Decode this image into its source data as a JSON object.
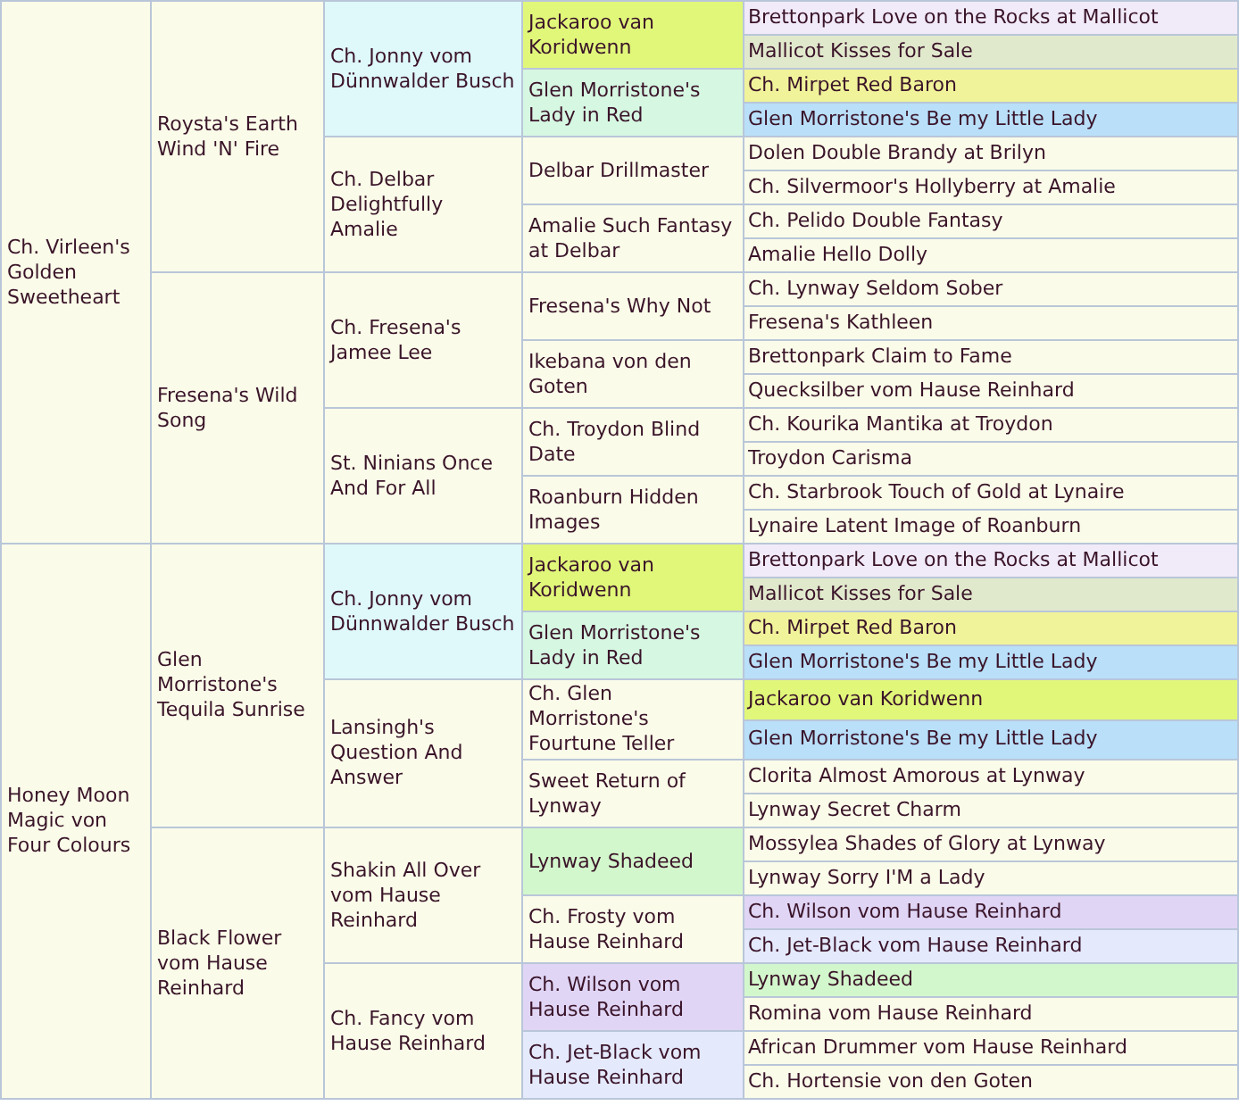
{
  "pedigree": [
    {
      "name": "Ch. Virleen's Golden Sweetheart",
      "children": [
        {
          "name": "Roysta's Earth Wind 'N' Fire",
          "children": [
            {
              "name": "Ch. Jonny vom Dünnwalder Busch",
              "color": "#dff8fa",
              "children": [
                {
                  "name": "Jackaroo van Koridwenn",
                  "color": "#e1f77a",
                  "children": [
                    {
                      "name": "Brettonpark Love on the Rocks at Mallicot",
                      "color": "#f1eaf8"
                    },
                    {
                      "name": "Mallicot Kisses for Sale",
                      "color": "#e1e9cd"
                    }
                  ]
                },
                {
                  "name": "Glen Morristone's Lady in Red",
                  "color": "#d6f7e2",
                  "children": [
                    {
                      "name": "Ch. Mirpet Red Baron",
                      "color": "#f0f39a"
                    },
                    {
                      "name": "Glen Morristone's Be my Little Lady",
                      "color": "#b9dff9"
                    }
                  ]
                }
              ]
            },
            {
              "name": "Ch. Delbar Delightfully Amalie",
              "children": [
                {
                  "name": "Delbar Drillmaster",
                  "children": [
                    {
                      "name": "Dolen Double Brandy at Brilyn"
                    },
                    {
                      "name": "Ch. Silvermoor's Hollyberry at Amalie"
                    }
                  ]
                },
                {
                  "name": "Amalie Such Fantasy at Delbar",
                  "children": [
                    {
                      "name": "Ch. Pelido Double Fantasy"
                    },
                    {
                      "name": "Amalie Hello Dolly"
                    }
                  ]
                }
              ]
            }
          ]
        },
        {
          "name": "Fresena's Wild Song",
          "children": [
            {
              "name": "Ch. Fresena's Jamee Lee",
              "children": [
                {
                  "name": "Fresena's Why Not",
                  "children": [
                    {
                      "name": "Ch. Lynway Seldom Sober"
                    },
                    {
                      "name": "Fresena's Kathleen"
                    }
                  ]
                },
                {
                  "name": "Ikebana von den Goten",
                  "children": [
                    {
                      "name": "Brettonpark Claim to Fame"
                    },
                    {
                      "name": "Quecksilber vom Hause Reinhard"
                    }
                  ]
                }
              ]
            },
            {
              "name": "St. Ninians Once And For All",
              "children": [
                {
                  "name": "Ch. Troydon Blind Date",
                  "children": [
                    {
                      "name": "Ch. Kourika Mantika at Troydon"
                    },
                    {
                      "name": "Troydon Carisma"
                    }
                  ]
                },
                {
                  "name": "Roanburn Hidden Images",
                  "children": [
                    {
                      "name": "Ch. Starbrook Touch of Gold at Lynaire"
                    },
                    {
                      "name": "Lynaire Latent Image of Roanburn"
                    }
                  ]
                }
              ]
            }
          ]
        }
      ]
    },
    {
      "name": "Honey Moon Magic von Four Colours",
      "children": [
        {
          "name": "Glen Morristone's Tequila Sunrise",
          "children": [
            {
              "name": "Ch. Jonny vom Dünnwalder Busch",
              "color": "#dff8fa",
              "children": [
                {
                  "name": "Jackaroo van Koridwenn",
                  "color": "#e1f77a",
                  "children": [
                    {
                      "name": "Brettonpark Love on the Rocks at Mallicot",
                      "color": "#f1eaf8"
                    },
                    {
                      "name": "Mallicot Kisses for Sale",
                      "color": "#e1e9cd"
                    }
                  ]
                },
                {
                  "name": "Glen Morristone's Lady in Red",
                  "color": "#d6f7e2",
                  "children": [
                    {
                      "name": "Ch. Mirpet Red Baron",
                      "color": "#f0f39a"
                    },
                    {
                      "name": "Glen Morristone's Be my Little Lady",
                      "color": "#b9dff9"
                    }
                  ]
                }
              ]
            },
            {
              "name": "Lansingh's Question And Answer",
              "children": [
                {
                  "name": "Ch. Glen Morristone's Fourtune Teller",
                  "children": [
                    {
                      "name": "Jackaroo van Koridwenn",
                      "color": "#e1f77a"
                    },
                    {
                      "name": "Glen Morristone's Be my Little Lady",
                      "color": "#b9dff9"
                    }
                  ]
                },
                {
                  "name": "Sweet Return of Lynway",
                  "children": [
                    {
                      "name": "Clorita Almost Amorous at Lynway"
                    },
                    {
                      "name": "Lynway Secret Charm"
                    }
                  ]
                }
              ]
            }
          ]
        },
        {
          "name": "Black Flower vom Hause Reinhard",
          "children": [
            {
              "name": "Shakin All Over vom Hause Reinhard",
              "children": [
                {
                  "name": "Lynway Shadeed",
                  "color": "#d3f7cc",
                  "children": [
                    {
                      "name": "Mossylea Shades of Glory at Lynway"
                    },
                    {
                      "name": "Lynway Sorry I'M a Lady"
                    }
                  ]
                },
                {
                  "name": "Ch. Frosty vom Hause Reinhard",
                  "children": [
                    {
                      "name": "Ch. Wilson vom Hause Reinhard",
                      "color": "#e0d5f5"
                    },
                    {
                      "name": "Ch. Jet-Black vom Hause Reinhard",
                      "color": "#e5e9fc"
                    }
                  ]
                }
              ]
            },
            {
              "name": "Ch. Fancy vom Hause Reinhard",
              "children": [
                {
                  "name": "Ch. Wilson vom Hause Reinhard",
                  "color": "#e0d5f5",
                  "children": [
                    {
                      "name": "Lynway Shadeed",
                      "color": "#d3f7cc"
                    },
                    {
                      "name": "Romina vom Hause Reinhard"
                    }
                  ]
                },
                {
                  "name": "Ch. Jet-Black vom Hause Reinhard",
                  "color": "#e5e9fc",
                  "children": [
                    {
                      "name": "African Drummer vom Hause Reinhard"
                    },
                    {
                      "name": "Ch. Hortensie von den Goten"
                    }
                  ]
                }
              ]
            }
          ]
        }
      ]
    }
  ]
}
